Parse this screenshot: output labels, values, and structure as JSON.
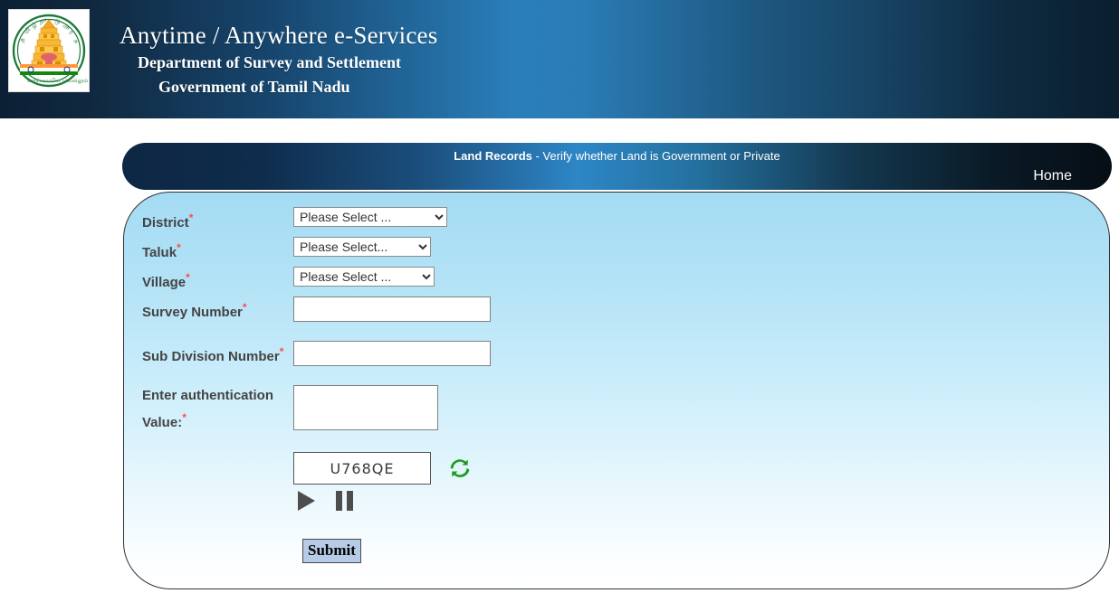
{
  "header": {
    "title": "Anytime / Anywhere e-Services",
    "subtitle1": "Department of Survey and Settlement",
    "subtitle2": "Government of Tamil Nadu",
    "emblem_alt": "tamil-nadu-state-emblem"
  },
  "titlebar": {
    "title_strong": "Land Records",
    "title_rest": " - Verify whether Land is Government or Private",
    "home_label": "Home"
  },
  "form": {
    "district": {
      "label": "District",
      "required": "*",
      "selected": "Please Select ...",
      "options": [
        "Please Select ..."
      ]
    },
    "taluk": {
      "label": "Taluk",
      "required": "*",
      "selected": "Please Select...",
      "options": [
        "Please Select..."
      ]
    },
    "village": {
      "label": "Village",
      "required": "*",
      "selected": "Please Select ...",
      "options": [
        "Please Select ..."
      ]
    },
    "survey_number": {
      "label": "Survey Number",
      "required": "*",
      "value": "",
      "placeholder": ""
    },
    "sub_division_number": {
      "label": "Sub Division Number",
      "required": "*",
      "value": "",
      "placeholder": ""
    },
    "authentication": {
      "label": "Enter authentication Value:",
      "required": "*",
      "value": "",
      "placeholder": ""
    },
    "captcha": {
      "code": "U768QE",
      "refresh_icon": "refresh-icon",
      "play_icon": "play-icon",
      "pause_icon": "pause-icon"
    },
    "submit_label": "Submit"
  },
  "colors": {
    "header_blue": "#2a7fba",
    "header_dark": "#0b2035",
    "panel_top": "#a4dcf4",
    "panel_bottom": "#ffffff",
    "label_text": "#444444",
    "required_red": "#ff4d4d",
    "submit_bg": "#b6cbe6",
    "refresh_green": "#1a9b1a"
  }
}
